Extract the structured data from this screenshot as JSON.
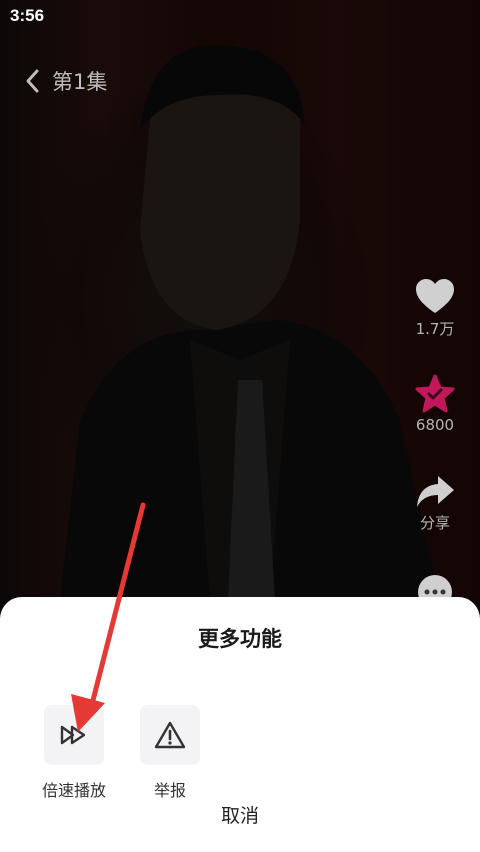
{
  "status_bar": {
    "time": "3:56"
  },
  "top_bar": {
    "episode_title": "第1集"
  },
  "side_actions": {
    "like_count": "1.7万",
    "favorite_count": "6800",
    "share_label": "分享"
  },
  "sheet": {
    "title": "更多功能",
    "functions": [
      {
        "label": "倍速播放",
        "icon": "speed-play-icon"
      },
      {
        "label": "举报",
        "icon": "report-warning-icon"
      }
    ],
    "cancel_label": "取消"
  },
  "colors": {
    "favorite_accent": "#c2185b",
    "annotation_arrow": "#e53935",
    "sheet_background": "#ffffff"
  }
}
